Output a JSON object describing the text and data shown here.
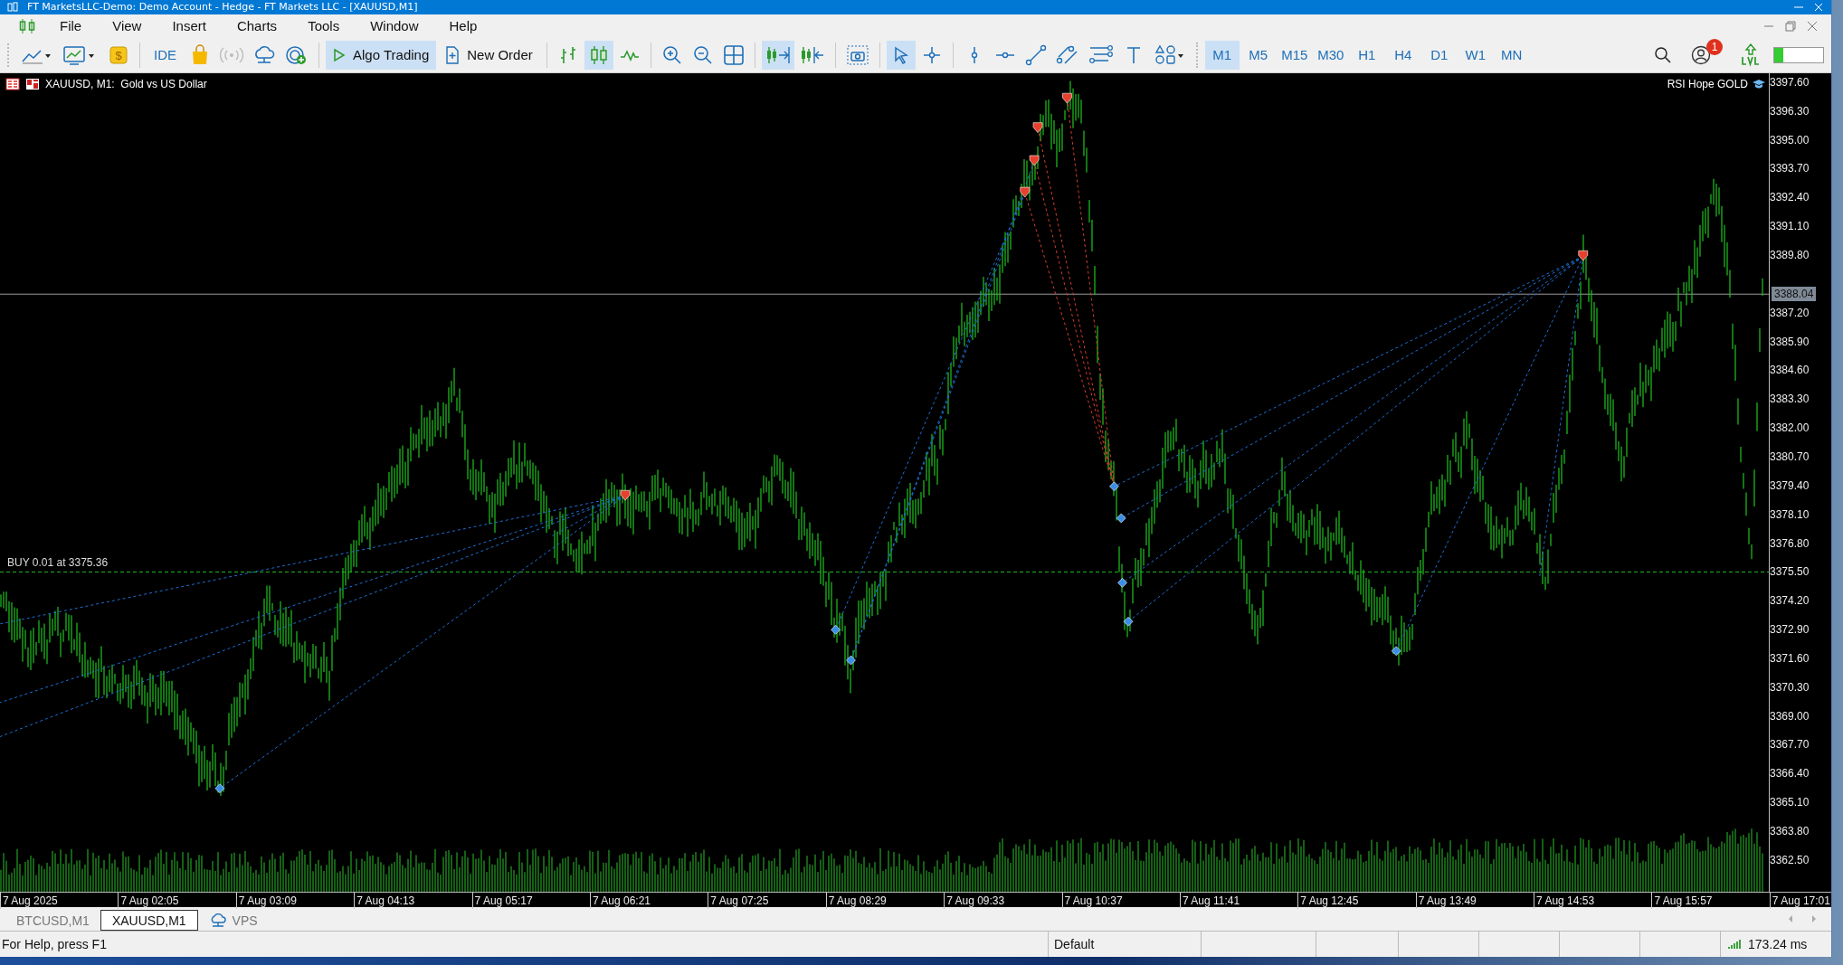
{
  "window": {
    "deposit_sign": "$",
    "title": "FT MarketsLLC-Demo: Demo Account - Hedge - FT Markets LLC - [XAUUSD,M1]"
  },
  "menu": [
    "File",
    "View",
    "Insert",
    "Charts",
    "Tools",
    "Window",
    "Help"
  ],
  "toolbar": {
    "ide": "IDE",
    "algo_trading": {
      "label": "Algo Trading",
      "on": true
    },
    "new_order": "New Order",
    "chart_types": [
      {
        "kind": "bars",
        "selected": false
      },
      {
        "kind": "candles",
        "selected": true
      },
      {
        "kind": "line",
        "selected": false
      }
    ],
    "auto_scroll": true,
    "chart_shift": false,
    "cursor_tools": [
      {
        "kind": "pointer",
        "selected": true
      },
      {
        "kind": "crosshair",
        "selected": false
      }
    ],
    "timeframes": [
      {
        "label": "M1",
        "selected": true
      },
      {
        "label": "M5",
        "selected": false
      },
      {
        "label": "M15",
        "selected": false
      },
      {
        "label": "M30",
        "selected": false
      },
      {
        "label": "H1",
        "selected": false
      },
      {
        "label": "H4",
        "selected": false
      },
      {
        "label": "D1",
        "selected": false
      },
      {
        "label": "W1",
        "selected": false
      },
      {
        "label": "MN",
        "selected": false
      }
    ],
    "notifications": "1",
    "meter": {
      "level": 0.18
    }
  },
  "chart": {
    "symbol": "XAUUSD, M1:",
    "description": "Gold vs US Dollar",
    "indicator": "RSI Hope GOLD",
    "order_line": "BUY 0.01 at 3375.36",
    "current_price": "3388.04",
    "price_axis": [
      "3397.60",
      "3396.30",
      "3395.00",
      "3393.70",
      "3392.40",
      "3391.10",
      "3389.80",
      "3387.20",
      "3385.90",
      "3384.60",
      "3383.30",
      "3382.00",
      "3380.70",
      "3379.40",
      "3378.10",
      "3376.80",
      "3375.50",
      "3374.20",
      "3372.90",
      "3371.60",
      "3370.30",
      "3369.00",
      "3367.70",
      "3366.40",
      "3365.10",
      "3363.80",
      "3362.50"
    ],
    "time_axis": [
      "7 Aug 2025",
      "7 Aug 02:05",
      "7 Aug 03:09",
      "7 Aug 04:13",
      "7 Aug 05:17",
      "7 Aug 06:21",
      "7 Aug 07:25",
      "7 Aug 08:29",
      "7 Aug 09:33",
      "7 Aug 10:37",
      "7 Aug 11:41",
      "7 Aug 12:45",
      "7 Aug 13:49",
      "7 Aug 14:53",
      "7 Aug 15:57",
      "7 Aug 17:01"
    ]
  },
  "tabs": [
    {
      "label": "BTCUSD,M1",
      "kind": "chart",
      "selected": false
    },
    {
      "label": "XAUUSD,M1",
      "kind": "chart",
      "selected": true
    },
    {
      "label": "VPS",
      "kind": "vps",
      "selected": false
    }
  ],
  "status_bar": {
    "help": "For Help, press F1",
    "profile": "Default",
    "ping": "173.24 ms"
  }
}
